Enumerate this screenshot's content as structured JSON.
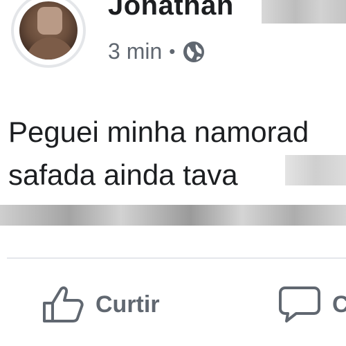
{
  "post": {
    "author_name": "Jonathan",
    "timestamp": "3 min",
    "separator": "•",
    "privacy_icon": "globe-icon",
    "text_line_1": "Peguei minha namorad",
    "text_line_2": "safada ainda tava"
  },
  "actions": {
    "like_label": "Curtir",
    "like_icon": "thumbs-up-icon",
    "comment_label": "C",
    "comment_icon": "comment-bubble-icon"
  },
  "colors": {
    "text_primary": "#1c1e21",
    "text_secondary": "#606770",
    "divider": "#e4e6eb"
  }
}
